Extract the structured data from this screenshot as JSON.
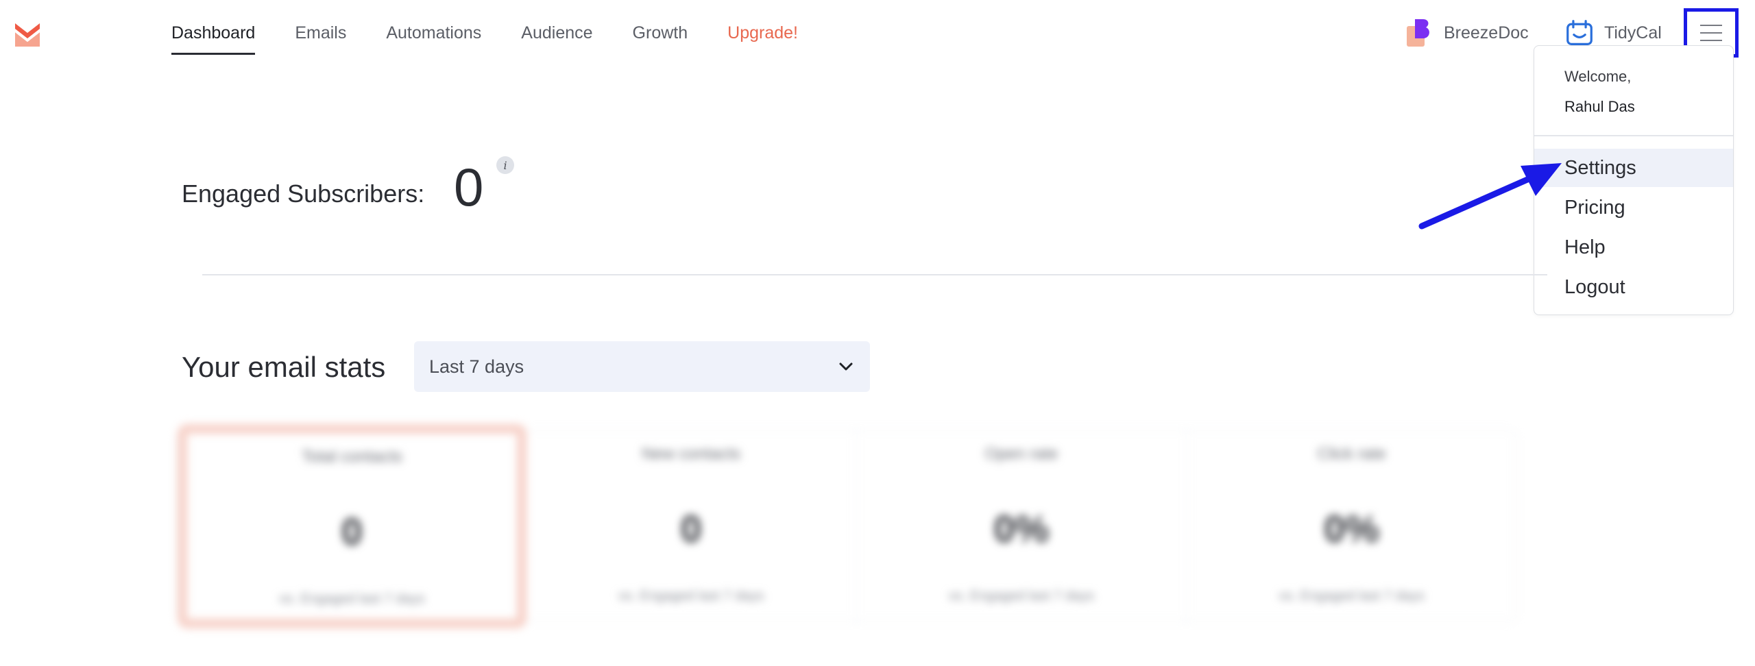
{
  "nav": {
    "items": [
      {
        "label": "Dashboard",
        "active": true
      },
      {
        "label": "Emails"
      },
      {
        "label": "Automations"
      },
      {
        "label": "Audience"
      },
      {
        "label": "Growth"
      },
      {
        "label": "Upgrade!",
        "accent": "#e8684f"
      }
    ]
  },
  "apps": {
    "breezedoc": {
      "label": "BreezeDoc",
      "icon": "breezedoc-icon"
    },
    "tidycal": {
      "label": "TidyCal",
      "icon": "calendar-icon"
    }
  },
  "menu": {
    "welcome": "Welcome,",
    "user": "Rahul Das",
    "items": [
      "Settings",
      "Pricing",
      "Help",
      "Logout"
    ]
  },
  "engaged": {
    "label": "Engaged Subscribers:",
    "value": "0",
    "info": "i"
  },
  "stats": {
    "title": "Your email stats",
    "range": "Last 7 days"
  },
  "cards": [
    {
      "title": "Total contacts",
      "value": "0",
      "sub": "vs. Engaged last 7 days"
    },
    {
      "title": "New contacts",
      "value": "0",
      "sub": "vs. Engaged last 7 days"
    },
    {
      "title": "Open rate",
      "value": "0%",
      "sub": "vs. Engaged last 7 days"
    },
    {
      "title": "Click rate",
      "value": "0%",
      "sub": "vs. Engaged last 7 days"
    }
  ],
  "colors": {
    "highlight_box": "#1a1ae6",
    "arrow": "#1a1ae6",
    "upgrade": "#e8684f"
  }
}
